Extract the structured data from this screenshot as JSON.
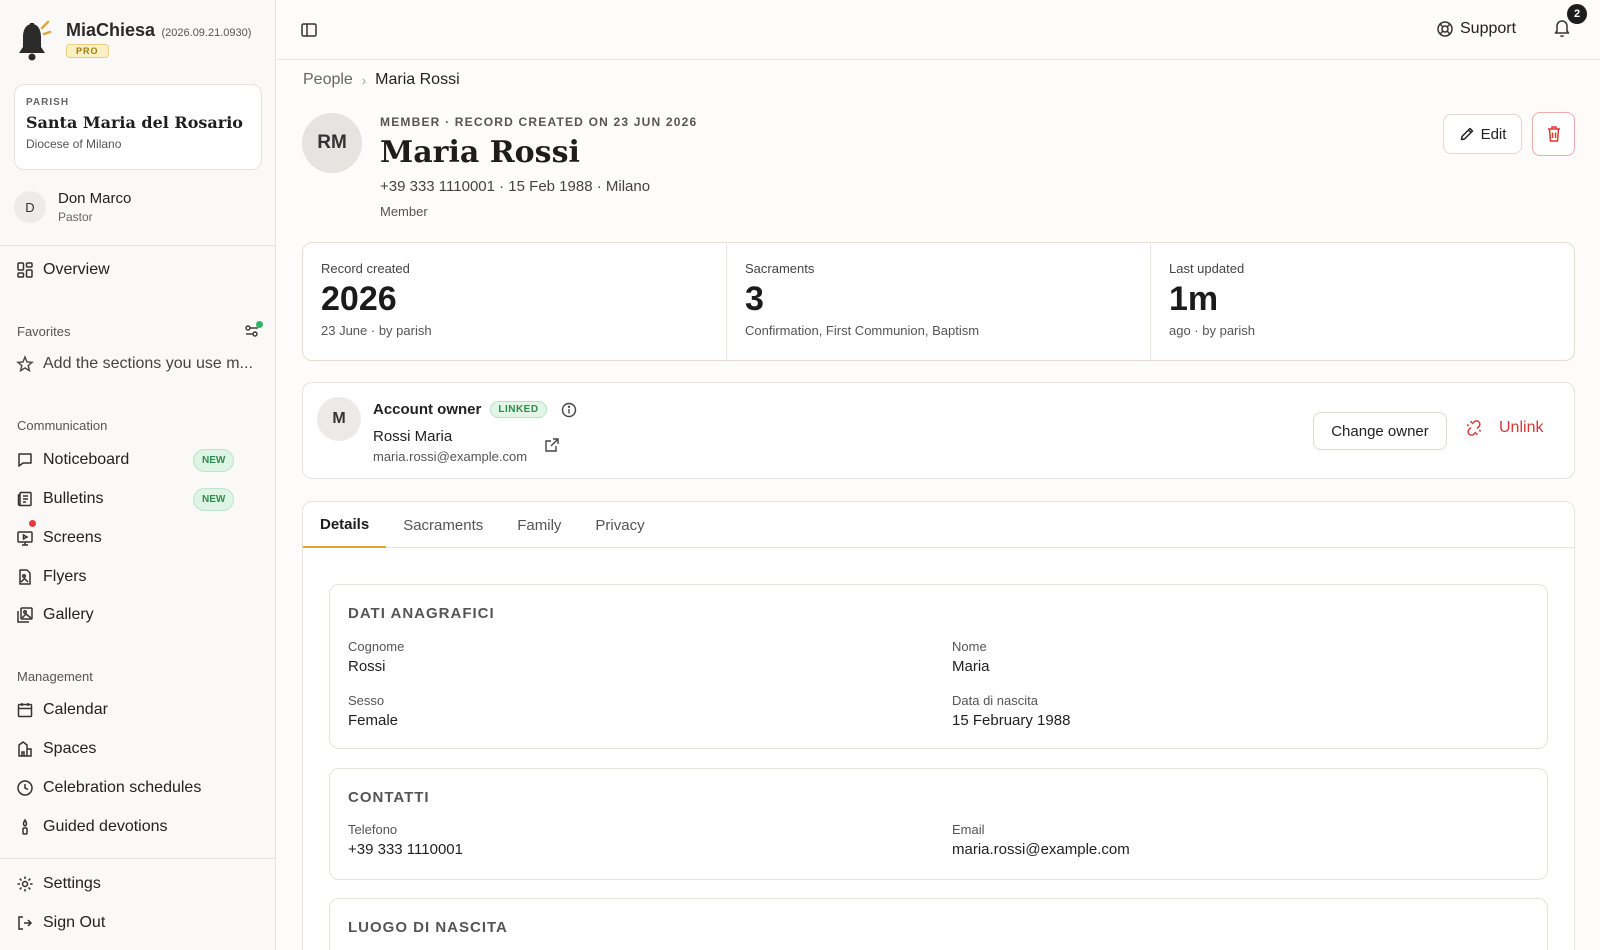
{
  "app": {
    "name": "MiaChiesa",
    "version": "(2026.09.21.0930)",
    "plan_badge": "PRO"
  },
  "parish": {
    "caption": "PARISH",
    "name": "Santa Maria del Rosario",
    "diocese": "Diocese of Milano"
  },
  "user": {
    "initial": "D",
    "name": "Don Marco",
    "role": "Pastor"
  },
  "nav": {
    "overview": "Overview",
    "favorites_heading": "Favorites",
    "favorites_hint": "Add the sections you use m...",
    "communication_heading": "Communication",
    "noticeboard": "Noticeboard",
    "bulletins": "Bulletins",
    "new_badge": "NEW",
    "screens": "Screens",
    "flyers": "Flyers",
    "gallery": "Gallery",
    "management_heading": "Management",
    "calendar": "Calendar",
    "spaces": "Spaces",
    "celebration_schedules": "Celebration schedules",
    "guided_devotions": "Guided devotions",
    "settings": "Settings",
    "sign_out": "Sign Out"
  },
  "topbar": {
    "support": "Support",
    "notifications": "2"
  },
  "breadcrumb": {
    "parent": "People",
    "sep": "›",
    "current": "Maria Rossi"
  },
  "person": {
    "initials": "RM",
    "meta": "MEMBER · RECORD CREATED ON 23 JUN 2026",
    "name": "Maria Rossi",
    "summary": "+39 333 1110001 · 15 Feb 1988 · Milano",
    "role": "Member",
    "edit": "Edit"
  },
  "stats": [
    {
      "label": "Record created",
      "value": "2026",
      "sub": "23 June · by parish"
    },
    {
      "label": "Sacraments",
      "value": "3",
      "sub": "Confirmation, First Communion, Baptism"
    },
    {
      "label": "Last updated",
      "value": "1m",
      "sub": "ago · by parish"
    }
  ],
  "account_owner": {
    "initial": "M",
    "title": "Account owner",
    "status": "LINKED",
    "name": "Rossi Maria",
    "email": "maria.rossi@example.com",
    "change": "Change owner",
    "unlink": "Unlink"
  },
  "tabs": [
    "Details",
    "Sacraments",
    "Family",
    "Privacy"
  ],
  "details": {
    "anagrafici": {
      "title": "DATI ANAGRAFICI",
      "cognome_label": "Cognome",
      "cognome": "Rossi",
      "nome_label": "Nome",
      "nome": "Maria",
      "sesso_label": "Sesso",
      "sesso": "Female",
      "nascita_label": "Data di nascita",
      "nascita": "15 February 1988"
    },
    "contatti": {
      "title": "CONTATTI",
      "telefono_label": "Telefono",
      "telefono": "+39 333 1110001",
      "email_label": "Email",
      "email": "maria.rossi@example.com"
    },
    "luogo": {
      "title": "LUOGO DI NASCITA"
    }
  },
  "colors": {
    "accent": "#d9a63a",
    "danger": "#d93838",
    "success": "#2e8b4e"
  }
}
